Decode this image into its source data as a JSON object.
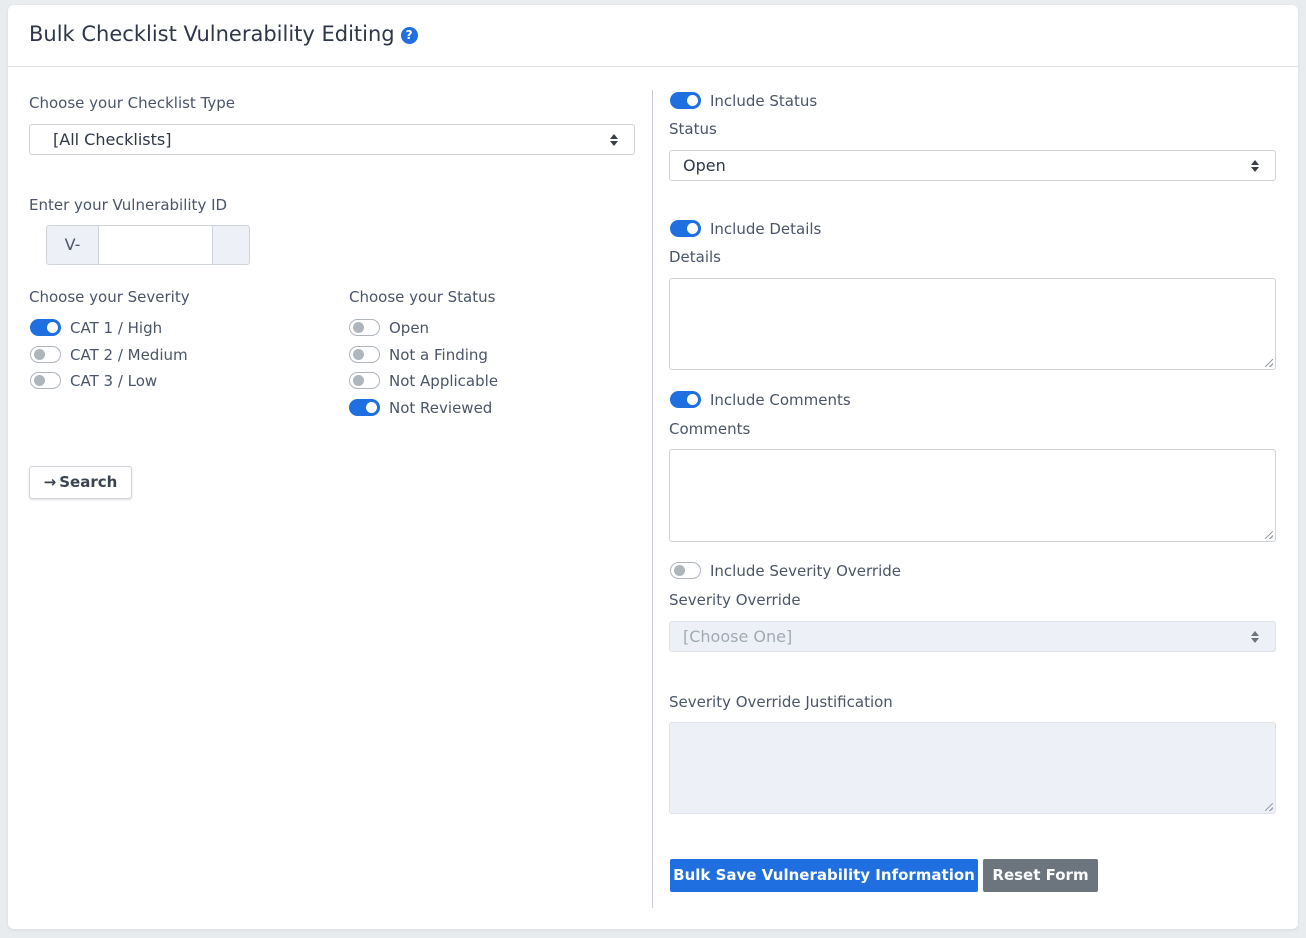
{
  "header": {
    "title": "Bulk Checklist Vulnerability Editing",
    "help_icon": "question-circle-icon"
  },
  "left": {
    "checklist_type_label": "Choose your Checklist Type",
    "checklist_type_value": "[All Checklists]",
    "vuln_id_label": "Enter your Vulnerability ID",
    "vuln_id_prefix": "V-",
    "vuln_id_value": "",
    "severity_label": "Choose your Severity",
    "severity_options": [
      {
        "label": "CAT 1 / High",
        "checked": true
      },
      {
        "label": "CAT 2 / Medium",
        "checked": false
      },
      {
        "label": "CAT 3 / Low",
        "checked": false
      }
    ],
    "status_label": "Choose your Status",
    "status_options": [
      {
        "label": "Open",
        "checked": false
      },
      {
        "label": "Not a Finding",
        "checked": false
      },
      {
        "label": "Not Applicable",
        "checked": false
      },
      {
        "label": "Not Reviewed",
        "checked": true
      }
    ],
    "search_button": "Search",
    "search_icon": "arrow-right-icon"
  },
  "right": {
    "include_status": {
      "label": "Include Status",
      "checked": true
    },
    "status_label": "Status",
    "status_value": "Open",
    "include_details": {
      "label": "Include Details",
      "checked": true
    },
    "details_label": "Details",
    "include_comments": {
      "label": "Include Comments",
      "checked": true
    },
    "comments_label": "Comments",
    "include_severity_override": {
      "label": "Include Severity Override",
      "checked": false
    },
    "severity_override_label": "Severity Override",
    "severity_override_value": "[Choose One]",
    "justification_label": "Severity Override Justification",
    "save_button": "Bulk Save Vulnerability Information",
    "reset_button": "Reset Form"
  },
  "colors": {
    "primary": "#1f6fe0",
    "secondary": "#6c757d"
  }
}
